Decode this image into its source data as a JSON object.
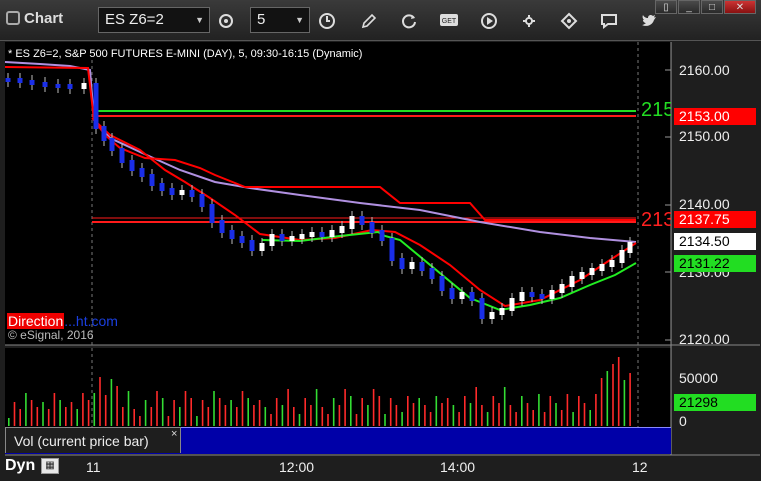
{
  "window": {
    "title": "Chart",
    "symbol": "ES Z6=2",
    "interval": "5",
    "buttons": [
      "pencil-icon",
      "cycle-icon",
      "get-icon",
      "play-icon",
      "link-icon",
      "chat-icon",
      "twitter-icon"
    ],
    "get_label": "GET"
  },
  "chart_header": "* ES Z6=2, S&P 500 FUTURES E-MINI (DAY), 5, 09:30-16:15 (Dynamic)",
  "copyright": "© eSignal, 2016",
  "watermark": {
    "a": "Direction",
    "b": "...ht.com"
  },
  "price_axis": {
    "ticks": [
      "2160.00",
      "2150.00",
      "2140.00",
      "2130.00",
      "2120.00"
    ],
    "tags": [
      {
        "label": "2153.00",
        "bg": "#ff0000",
        "fg": "#ffffff"
      },
      {
        "label": "2137.75",
        "bg": "#ff0000",
        "fg": "#ffffff"
      },
      {
        "label": "2134.50",
        "bg": "#ffffff",
        "fg": "#000000"
      },
      {
        "label": "2131.22",
        "bg": "#22dd22",
        "fg": "#000000"
      }
    ],
    "line_labels": [
      {
        "text": "215",
        "color": "#22dd22"
      },
      {
        "text": "213",
        "color": "#ff2020"
      }
    ]
  },
  "volume_axis": {
    "ticks": [
      "50000",
      "0"
    ],
    "tag": {
      "label": "21298",
      "bg": "#22dd22",
      "fg": "#000000"
    }
  },
  "volume_panel": {
    "label": "Vol (current price bar)",
    "close": "×"
  },
  "footer": {
    "dyn_label": "Dyn",
    "dyn_icon": "calendar-icon",
    "time_labels": [
      "11",
      "12:00",
      "14:00",
      "12"
    ]
  },
  "colors": {
    "up_candle": "#ffffff",
    "down_candle": "#1a2ee8",
    "resistance": "#ff1a1a",
    "support": "#22dd22",
    "vwap": "#b090e0",
    "red_ma": "#ff0000",
    "green_ma": "#22ee22"
  },
  "chart_data": {
    "type": "line",
    "ylim": [
      2118,
      2166
    ],
    "series": [
      {
        "name": "",
        "values": []
      }
    ]
  }
}
